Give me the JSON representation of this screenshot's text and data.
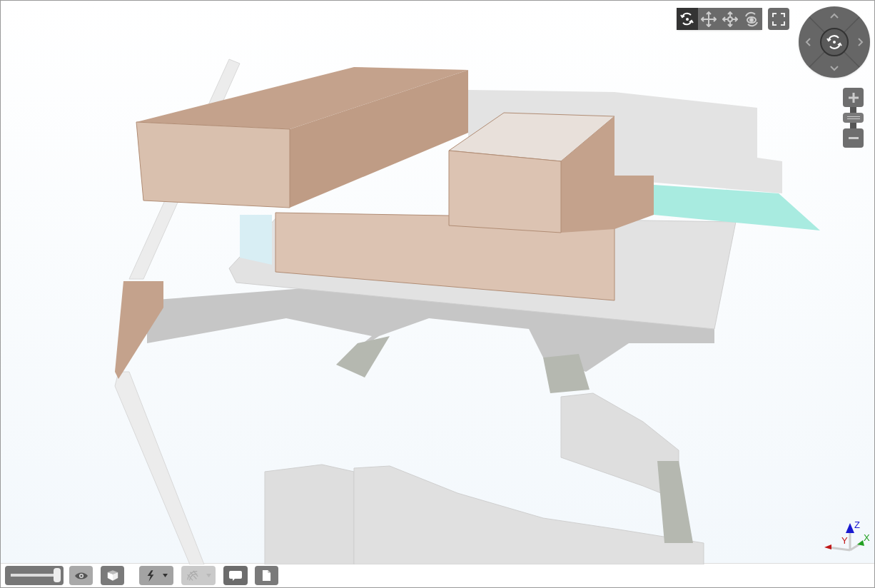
{
  "view_tools": [
    {
      "kind": "orbit",
      "selected": true
    },
    {
      "kind": "pan",
      "selected": false
    },
    {
      "kind": "walk",
      "selected": false
    },
    {
      "kind": "look",
      "selected": false
    }
  ],
  "bottom_toolbar": {
    "slider": {
      "level": 0.95
    },
    "buttons": [
      {
        "kind": "eye",
        "disabled": false
      },
      {
        "kind": "cube",
        "disabled": false
      },
      {
        "kind": "lightning",
        "disabled": false
      },
      {
        "kind": "wireframe",
        "disabled": true
      },
      {
        "kind": "comment",
        "disabled": false
      },
      {
        "kind": "page",
        "disabled": false
      }
    ]
  },
  "axis_triad": {
    "x": "X",
    "y": "Y",
    "z": "Z"
  }
}
